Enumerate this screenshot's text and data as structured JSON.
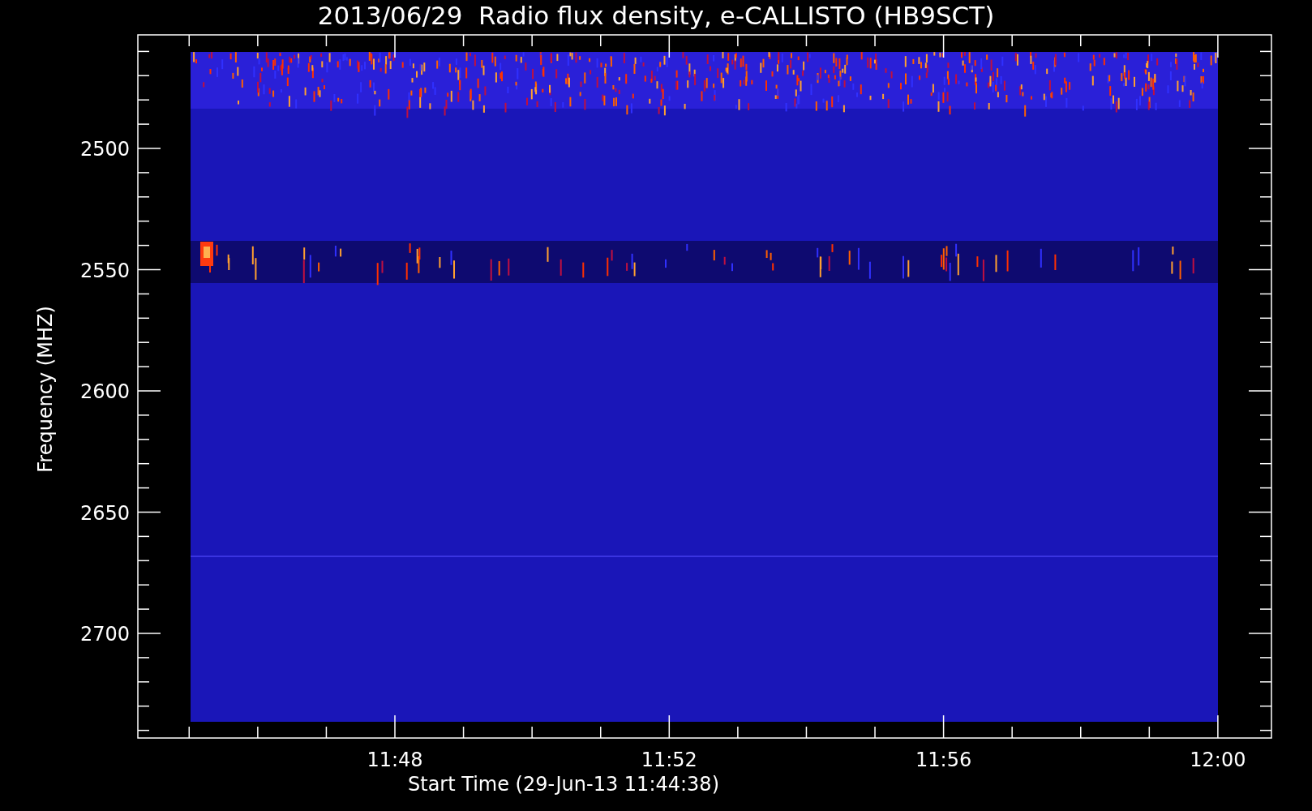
{
  "plot": {
    "title": "2013/06/29  Radio flux density, e-CALLISTO (HB9SCT)",
    "y_axis": {
      "label": "Frequency (MHZ)",
      "ticks": [
        "2500",
        "2550",
        "2600",
        "2650",
        "2700"
      ]
    },
    "x_axis": {
      "label": "Start Time (29-Jun-13 11:44:38)",
      "ticks": [
        "11:48",
        "11:52",
        "11:56",
        "12:00"
      ]
    }
  }
}
